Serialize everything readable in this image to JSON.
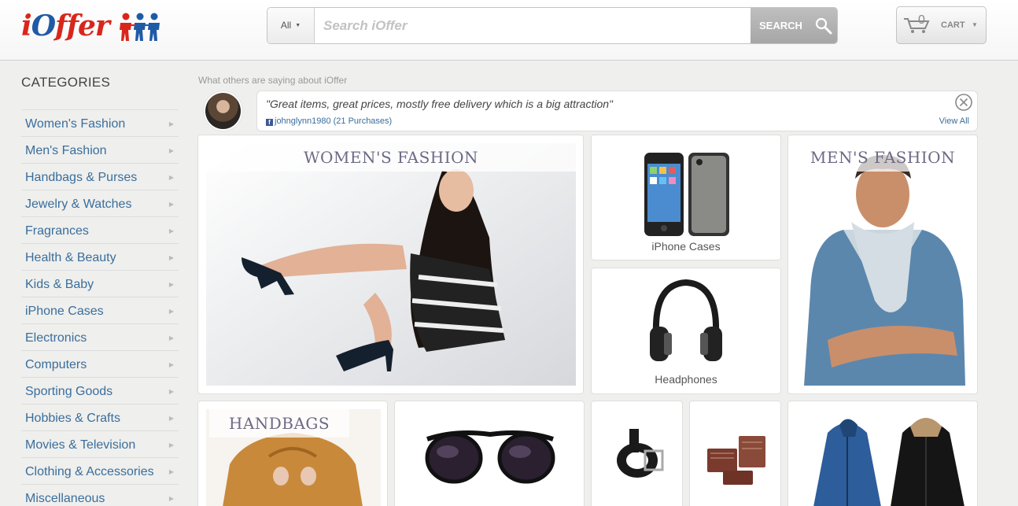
{
  "header": {
    "logo": "iOffer",
    "search": {
      "category": "All",
      "placeholder": "Search iOffer",
      "button_label": "SEARCH"
    },
    "cart": {
      "count": "0",
      "label": "CART"
    }
  },
  "sidebar": {
    "title": "CATEGORIES",
    "items": [
      {
        "label": "Women's Fashion"
      },
      {
        "label": "Men's Fashion"
      },
      {
        "label": "Handbags & Purses"
      },
      {
        "label": "Jewelry & Watches"
      },
      {
        "label": "Fragrances"
      },
      {
        "label": "Health & Beauty"
      },
      {
        "label": "Kids & Baby"
      },
      {
        "label": "iPhone Cases"
      },
      {
        "label": "Electronics"
      },
      {
        "label": "Computers"
      },
      {
        "label": "Sporting Goods"
      },
      {
        "label": "Hobbies & Crafts"
      },
      {
        "label": "Movies & Television"
      },
      {
        "label": "Clothing & Accessories"
      },
      {
        "label": "Miscellaneous"
      }
    ]
  },
  "testimonial": {
    "title": "What others are saying about iOffer",
    "quote": "\"Great items, great prices, mostly free delivery which is a big attraction\"",
    "user": "johnglynn1980 (21 Purchases)",
    "view_all": "View All"
  },
  "tiles": {
    "womens": {
      "banner": "WOMEN'S FASHION"
    },
    "iphone": {
      "caption": "iPhone Cases"
    },
    "headphones": {
      "caption": "Headphones"
    },
    "mens": {
      "banner": "MEN'S FASHION"
    },
    "handbags": {
      "banner": "HANDBAGS"
    }
  },
  "colors": {
    "link": "#3a6e9c",
    "logo_red": "#d9261c",
    "logo_blue": "#1f5aa6",
    "banner_text": "#6d6a86"
  }
}
